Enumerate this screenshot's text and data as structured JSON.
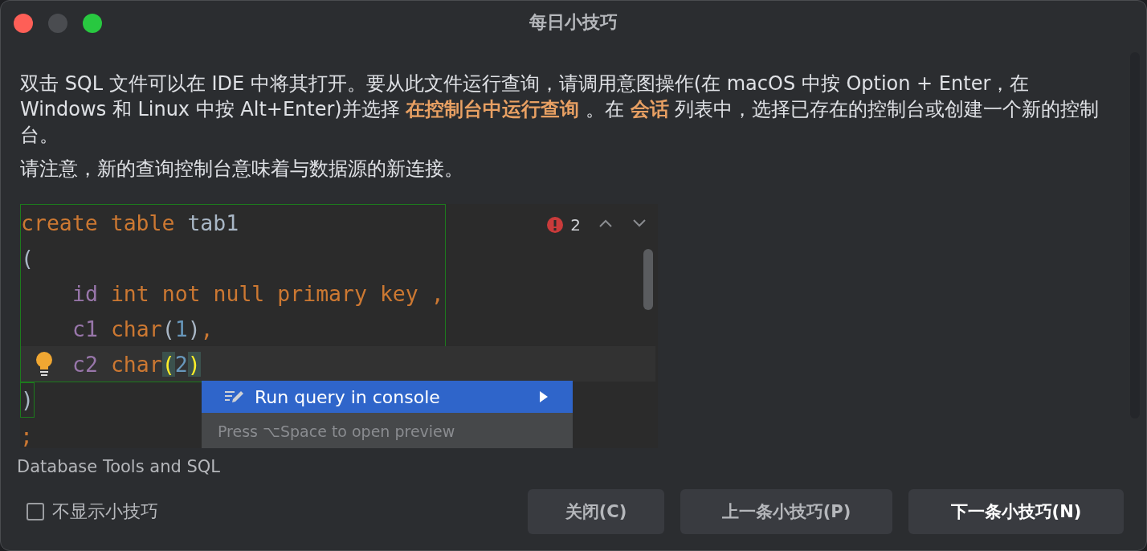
{
  "window": {
    "title": "每日小技巧"
  },
  "tip": {
    "paragraphs": [
      "双击 SQL 文件可以在 IDE 中将其打开。要从此文件运行查询，请调用意图操作(在 macOS 中按 Option + Enter，在 Windows 和 Linux 中按 Alt+Enter)并选择 **在控制台中运行查询** 。在 **会话** 列表中，选择已存在的控制台或创建一个新的控制台。",
      "请注意，新的查询控制台意味着与数据源的新连接。"
    ]
  },
  "editor": {
    "error_count": "2",
    "lines": [
      {
        "indented": false,
        "current": false,
        "framed": true,
        "tokens": [
          {
            "text": "create table",
            "kind": "keyword"
          },
          {
            "text": " tab1",
            "kind": "plain"
          }
        ]
      },
      {
        "indented": false,
        "current": false,
        "framed": true,
        "tokens": [
          {
            "text": "(",
            "kind": "plain"
          }
        ]
      },
      {
        "indented": true,
        "current": false,
        "framed": true,
        "tokens": [
          {
            "text": "id",
            "kind": "column"
          },
          {
            "text": " int not null primary key ,",
            "kind": "keyword"
          }
        ]
      },
      {
        "indented": true,
        "current": false,
        "framed": true,
        "tokens": [
          {
            "text": "c1",
            "kind": "column"
          },
          {
            "text": " char",
            "kind": "keyword"
          },
          {
            "text": "(",
            "kind": "plain"
          },
          {
            "text": "1",
            "kind": "number"
          },
          {
            "text": ")",
            "kind": "plain"
          },
          {
            "text": ",",
            "kind": "keyword"
          }
        ]
      },
      {
        "indented": true,
        "current": true,
        "framed": true,
        "bulb": true,
        "tokens": [
          {
            "text": "c2",
            "kind": "column"
          },
          {
            "text": " char",
            "kind": "keyword"
          },
          {
            "text": "(",
            "kind": "match"
          },
          {
            "text": "2",
            "kind": "number"
          },
          {
            "text": ")",
            "kind": "match"
          }
        ]
      },
      {
        "indented": false,
        "current": false,
        "framed": false,
        "tokens": [
          {
            "text": ")",
            "kind": "boxed"
          }
        ]
      },
      {
        "indented": false,
        "current": false,
        "framed": false,
        "tokens": [
          {
            "text": ";",
            "kind": "keyword"
          }
        ]
      }
    ],
    "popup": {
      "items": [
        {
          "label": "Run query in console",
          "selected": true
        }
      ],
      "hint": "Press ⌥Space to open preview"
    }
  },
  "category": "Database Tools and SQL",
  "dont_show": {
    "label": "不显示小技巧",
    "checked": false
  },
  "buttons": [
    {
      "label": "关闭(C)",
      "default": false
    },
    {
      "label": "上一条小技巧(P)",
      "default": false
    },
    {
      "label": "下一条小技巧(N)",
      "default": true
    }
  ]
}
